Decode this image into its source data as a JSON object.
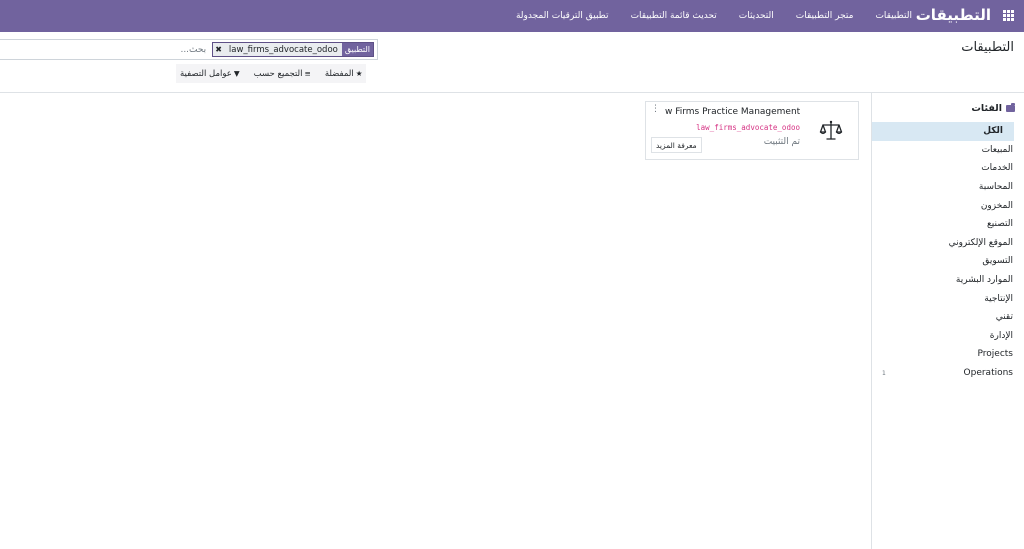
{
  "navbar": {
    "title": "التطبيقات",
    "menu": [
      "التطبيقات",
      "متجر التطبيقات",
      "التحديثات",
      "تحديث قائمة التطبيقات",
      "تطبيق الترقيات المجدولة"
    ],
    "apps_icon": "grid-icon",
    "background_color": "#71639e"
  },
  "control_panel": {
    "page_title": "التطبيقات",
    "search": {
      "facet_label": "التطبيق",
      "facet_value": "law_firms_advocate_odoo",
      "facet_remove": "✖",
      "placeholder": "بحث..."
    },
    "options": {
      "filters_icon": "▼",
      "filters": "عوامل التصفية",
      "group_by_icon": "≡",
      "group_by": "التجميع حسب",
      "favorites_icon": "★",
      "favorites": "المفضلة"
    }
  },
  "sidebar": {
    "header": "الفئات",
    "header_icon": "folder-icon",
    "items": [
      {
        "label": "الكل",
        "active": true,
        "count": ""
      },
      {
        "label": "المبيعات",
        "count": ""
      },
      {
        "label": "الخدمات",
        "count": ""
      },
      {
        "label": "المحاسبة",
        "count": ""
      },
      {
        "label": "المخزون",
        "count": ""
      },
      {
        "label": "التصنيع",
        "count": ""
      },
      {
        "label": "الموقع الإلكتروني",
        "count": ""
      },
      {
        "label": "التسويق",
        "count": ""
      },
      {
        "label": "الموارد البشرية",
        "count": ""
      },
      {
        "label": "الإنتاجية",
        "count": ""
      },
      {
        "label": "تقني",
        "count": ""
      },
      {
        "label": "الإدارة",
        "count": ""
      },
      {
        "label": "Projects",
        "count": ""
      },
      {
        "label": "Operations",
        "count": "1"
      }
    ]
  },
  "app_card": {
    "name": "w Firms Practice Management…",
    "technical_name": "law_firms_advocate_odoo",
    "status": "تم التثبيت",
    "learn_more": "معرفة المزيد",
    "menu_dots": "⋮",
    "icon": "scales-icon",
    "technical_name_color": "#d63384"
  }
}
